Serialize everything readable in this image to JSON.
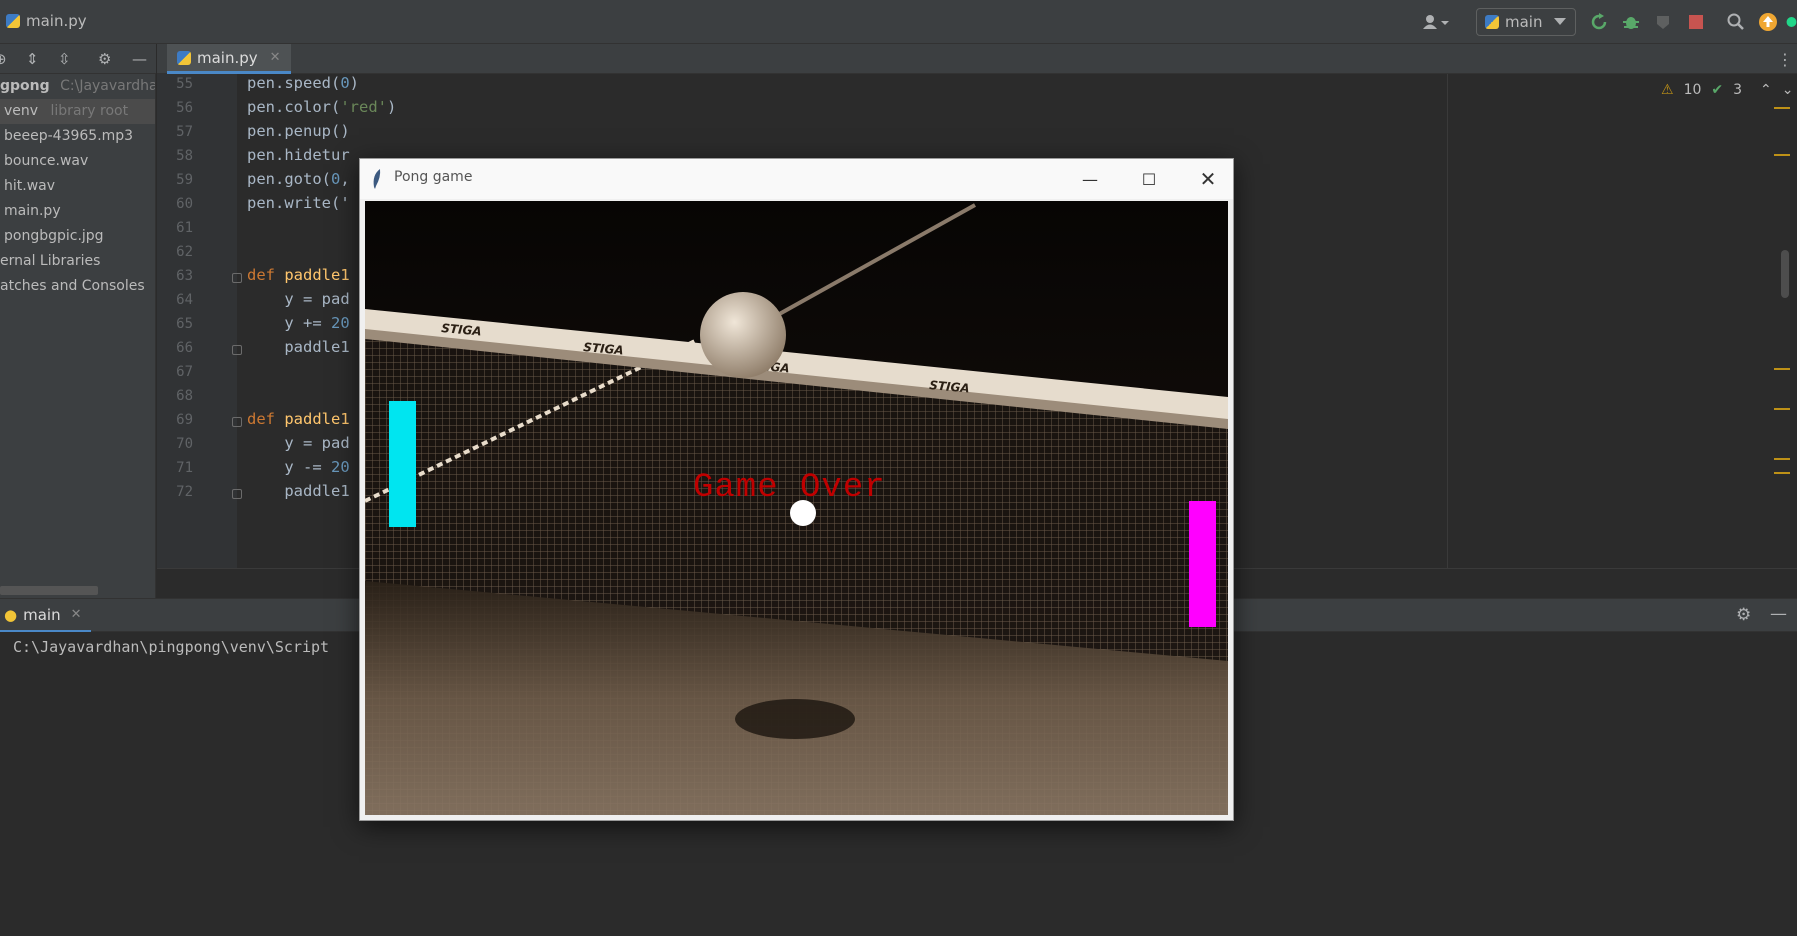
{
  "window": {
    "file_title": "main.py"
  },
  "toolbar": {
    "run_config": "main"
  },
  "editor_tab": {
    "label": "main.py"
  },
  "project": {
    "root_name": "gpong",
    "root_path": "C:\\Jayavardhan\\",
    "items": [
      {
        "label": "venv",
        "hint": "library root"
      },
      {
        "label": "beeep-43965.mp3"
      },
      {
        "label": "bounce.wav"
      },
      {
        "label": "hit.wav"
      },
      {
        "label": "main.py"
      },
      {
        "label": "pongbgpic.jpg"
      },
      {
        "label": "ernal Libraries"
      },
      {
        "label": "atches and Consoles"
      }
    ]
  },
  "inspections": {
    "warnings": "10",
    "ok": "3"
  },
  "code_lines": [
    {
      "n": "55",
      "text": "pen.speed(0)"
    },
    {
      "n": "56",
      "text": "pen.color('red')"
    },
    {
      "n": "57",
      "text": "pen.penup()"
    },
    {
      "n": "58",
      "text": "pen.hidetur"
    },
    {
      "n": "59",
      "text": "pen.goto(0,"
    },
    {
      "n": "60",
      "text": "pen.write('"
    },
    {
      "n": "61",
      "text": ""
    },
    {
      "n": "62",
      "text": ""
    },
    {
      "n": "63",
      "text": "def paddle1"
    },
    {
      "n": "64",
      "text": "    y = pad"
    },
    {
      "n": "65",
      "text": "    y += 20"
    },
    {
      "n": "66",
      "text": "    paddle1"
    },
    {
      "n": "67",
      "text": ""
    },
    {
      "n": "68",
      "text": ""
    },
    {
      "n": "69",
      "text": "def paddle1"
    },
    {
      "n": "70",
      "text": "    y = pad"
    },
    {
      "n": "71",
      "text": "    y -= 20"
    },
    {
      "n": "72",
      "text": "    paddle1"
    }
  ],
  "run": {
    "tab_label": "main",
    "console_text": "C:\\Jayavardhan\\pingpong\\venv\\Script"
  },
  "pong": {
    "title": "Pong game",
    "message": "Game Over",
    "left_paddle_color": "#00e5f0",
    "right_paddle_color": "#ff00ff",
    "ball_color": "#ffffff",
    "net_brand": "STIGA"
  },
  "colors": {
    "accent": "#4a88c7",
    "warning": "#be9117",
    "success": "#59a869"
  }
}
